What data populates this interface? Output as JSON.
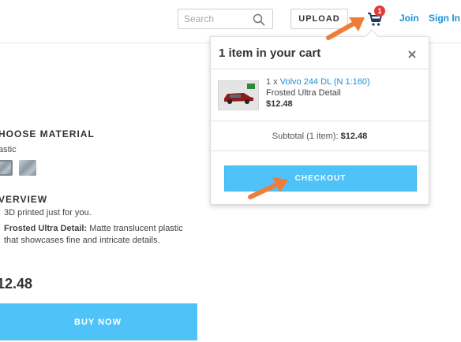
{
  "header": {
    "search_placeholder": "Search",
    "upload_label": "UPLOAD",
    "cart_count": "1",
    "join_label": "Join",
    "signin_label": "Sign In"
  },
  "product": {
    "material_heading": "HOOSE MATERIAL",
    "material_value": "astic",
    "overview_heading": "VERVIEW",
    "bullet1": "3D printed just for you.",
    "bullet2_bold": "Frosted Ultra Detail:",
    "bullet2_rest": " Matte translucent plastic",
    "bullet2_line2": "that showcases fine and intricate details.",
    "price": "12.48",
    "buy_label": "BUY NOW"
  },
  "cart_popup": {
    "title": "1 item in your cart",
    "close_icon": "close-icon",
    "item": {
      "qty_prefix": "1 x ",
      "name": "Volvo 244 DL (N 1:160)",
      "material": "Frosted Ultra Detail",
      "price": "$12.48"
    },
    "subtotal_label": "Subtotal (1 item): ",
    "subtotal_value": "$12.48",
    "checkout_label": "CHECKOUT"
  },
  "colors": {
    "accent": "#4fc3f7",
    "link": "#1a8fd6",
    "badge": "#e03c3c",
    "annotation_arrow": "#f07c3a"
  },
  "icons": [
    "search-icon",
    "cart-icon",
    "close-icon",
    "arrow-annotation"
  ]
}
